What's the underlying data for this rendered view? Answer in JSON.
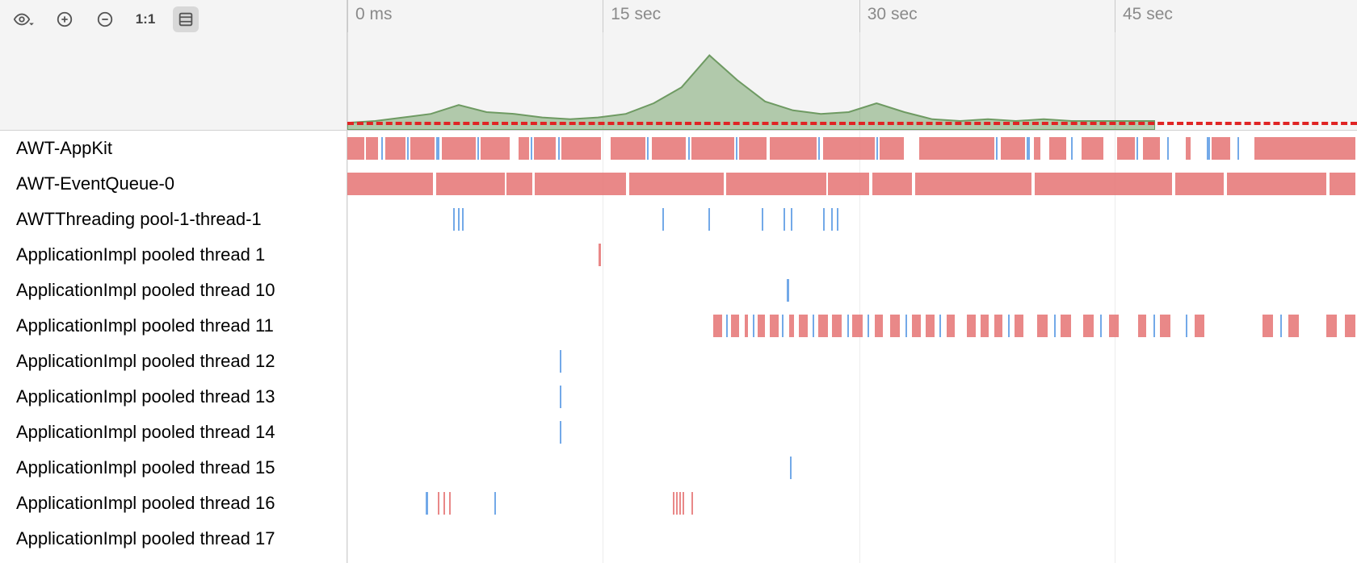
{
  "toolbar": {
    "eye_label": "visibility",
    "zoom_in_label": "zoom-in",
    "zoom_out_label": "zoom-out",
    "actual_size_label": "1:1",
    "boxed_label": "toggle-collapse"
  },
  "time_axis": {
    "ticks": [
      {
        "pct": 0,
        "label": "0 ms"
      },
      {
        "pct": 25.3,
        "label": "15 sec"
      },
      {
        "pct": 50.7,
        "label": "30 sec"
      },
      {
        "pct": 76.0,
        "label": "45 sec"
      }
    ],
    "grid_pct": [
      0,
      25.3,
      50.7,
      76.0
    ]
  },
  "chart_data": {
    "type": "area",
    "title": "",
    "xlabel": "time",
    "ylabel": "",
    "x_unit": "sec",
    "ylim": [
      0,
      100
    ],
    "baseline_pct": 8,
    "x": [
      0,
      2,
      4,
      6,
      8,
      10,
      12,
      14,
      16,
      18,
      20,
      22,
      24,
      26,
      28,
      30,
      32,
      34,
      36,
      38,
      40,
      42,
      44,
      46,
      48,
      50,
      52,
      54,
      56,
      58
    ],
    "values": [
      8,
      10,
      14,
      18,
      28,
      20,
      18,
      14,
      12,
      14,
      18,
      30,
      48,
      84,
      56,
      32,
      22,
      18,
      20,
      30,
      20,
      12,
      10,
      12,
      10,
      12,
      10,
      10,
      10,
      10
    ]
  },
  "threads": [
    {
      "name": "AWT-AppKit",
      "events": [
        {
          "s": 0,
          "e": 1.0,
          "c": "red"
        },
        {
          "s": 1.1,
          "e": 1.8,
          "c": "red"
        },
        {
          "s": 2.0,
          "e": 2.1,
          "c": "blue"
        },
        {
          "s": 2.2,
          "e": 3.4,
          "c": "red"
        },
        {
          "s": 3.5,
          "e": 3.6,
          "c": "blue"
        },
        {
          "s": 3.7,
          "e": 5.1,
          "c": "red"
        },
        {
          "s": 5.2,
          "e": 5.4,
          "c": "blue"
        },
        {
          "s": 5.5,
          "e": 7.5,
          "c": "red"
        },
        {
          "s": 7.6,
          "e": 7.7,
          "c": "blue"
        },
        {
          "s": 7.8,
          "e": 9.5,
          "c": "red"
        },
        {
          "s": 10.0,
          "e": 10.6,
          "c": "red"
        },
        {
          "s": 10.7,
          "e": 10.8,
          "c": "blue"
        },
        {
          "s": 10.9,
          "e": 12.2,
          "c": "red"
        },
        {
          "s": 12.3,
          "e": 12.4,
          "c": "blue"
        },
        {
          "s": 12.5,
          "e": 14.8,
          "c": "red"
        },
        {
          "s": 15.4,
          "e": 17.4,
          "c": "red"
        },
        {
          "s": 17.5,
          "e": 17.6,
          "c": "blue"
        },
        {
          "s": 17.8,
          "e": 19.8,
          "c": "red"
        },
        {
          "s": 19.9,
          "e": 20.0,
          "c": "blue"
        },
        {
          "s": 20.1,
          "e": 22.6,
          "c": "red"
        },
        {
          "s": 22.7,
          "e": 22.8,
          "c": "blue"
        },
        {
          "s": 22.9,
          "e": 24.5,
          "c": "red"
        },
        {
          "s": 24.7,
          "e": 27.4,
          "c": "red"
        },
        {
          "s": 27.5,
          "e": 27.6,
          "c": "blue"
        },
        {
          "s": 27.8,
          "e": 30.8,
          "c": "red"
        },
        {
          "s": 30.9,
          "e": 31.0,
          "c": "blue"
        },
        {
          "s": 31.1,
          "e": 32.5,
          "c": "red"
        },
        {
          "s": 33.4,
          "e": 37.8,
          "c": "red"
        },
        {
          "s": 37.9,
          "e": 38.0,
          "c": "blue"
        },
        {
          "s": 38.2,
          "e": 39.6,
          "c": "red"
        },
        {
          "s": 39.7,
          "e": 39.9,
          "c": "blue"
        },
        {
          "s": 40.1,
          "e": 40.5,
          "c": "red"
        },
        {
          "s": 41.0,
          "e": 42.0,
          "c": "red"
        },
        {
          "s": 42.3,
          "e": 42.4,
          "c": "blue"
        },
        {
          "s": 42.9,
          "e": 44.2,
          "c": "red"
        },
        {
          "s": 45.0,
          "e": 46.0,
          "c": "red"
        },
        {
          "s": 46.1,
          "e": 46.2,
          "c": "blue"
        },
        {
          "s": 46.5,
          "e": 47.5,
          "c": "red"
        },
        {
          "s": 47.9,
          "e": 48.0,
          "c": "blue"
        },
        {
          "s": 49.0,
          "e": 49.3,
          "c": "red"
        },
        {
          "s": 50.2,
          "e": 50.4,
          "c": "blue"
        },
        {
          "s": 50.5,
          "e": 51.6,
          "c": "red"
        },
        {
          "s": 52.0,
          "e": 52.1,
          "c": "blue"
        },
        {
          "s": 53.0,
          "e": 58.9,
          "c": "red"
        }
      ]
    },
    {
      "name": "AWT-EventQueue-0",
      "events": [
        {
          "s": 0,
          "e": 5.0,
          "c": "red"
        },
        {
          "s": 5.2,
          "e": 9.2,
          "c": "red"
        },
        {
          "s": 9.3,
          "e": 10.8,
          "c": "red"
        },
        {
          "s": 10.95,
          "e": 16.3,
          "c": "red"
        },
        {
          "s": 16.45,
          "e": 22.0,
          "c": "red"
        },
        {
          "s": 22.15,
          "e": 28.0,
          "c": "red"
        },
        {
          "s": 28.1,
          "e": 30.5,
          "c": "red"
        },
        {
          "s": 30.7,
          "e": 33.0,
          "c": "red"
        },
        {
          "s": 33.2,
          "e": 40.0,
          "c": "red"
        },
        {
          "s": 40.15,
          "e": 48.2,
          "c": "red"
        },
        {
          "s": 48.4,
          "e": 51.2,
          "c": "red"
        },
        {
          "s": 51.4,
          "e": 57.2,
          "c": "red"
        },
        {
          "s": 57.4,
          "e": 58.9,
          "c": "red"
        }
      ]
    },
    {
      "name": "AWTThreading pool-1-thread-1",
      "events": [
        {
          "s": 6.2,
          "e": 6.3,
          "c": "blue"
        },
        {
          "s": 6.45,
          "e": 6.55,
          "c": "blue"
        },
        {
          "s": 6.7,
          "e": 6.8,
          "c": "blue"
        },
        {
          "s": 18.4,
          "e": 18.5,
          "c": "blue"
        },
        {
          "s": 21.1,
          "e": 21.2,
          "c": "blue"
        },
        {
          "s": 24.2,
          "e": 24.3,
          "c": "blue"
        },
        {
          "s": 25.5,
          "e": 25.6,
          "c": "blue"
        },
        {
          "s": 25.9,
          "e": 26.0,
          "c": "blue"
        },
        {
          "s": 27.8,
          "e": 27.9,
          "c": "blue"
        },
        {
          "s": 28.25,
          "e": 28.35,
          "c": "blue"
        },
        {
          "s": 28.6,
          "e": 28.7,
          "c": "blue"
        }
      ]
    },
    {
      "name": "ApplicationImpl pooled thread 1",
      "events": [
        {
          "s": 14.7,
          "e": 14.8,
          "c": "red"
        }
      ]
    },
    {
      "name": "ApplicationImpl pooled thread 10",
      "events": [
        {
          "s": 25.7,
          "e": 25.8,
          "c": "blue"
        }
      ]
    },
    {
      "name": "ApplicationImpl pooled thread 11",
      "events": [
        {
          "s": 21.4,
          "e": 21.9,
          "c": "red"
        },
        {
          "s": 22.15,
          "e": 22.25,
          "c": "blue"
        },
        {
          "s": 22.4,
          "e": 22.9,
          "c": "red"
        },
        {
          "s": 23.2,
          "e": 23.4,
          "c": "red"
        },
        {
          "s": 23.7,
          "e": 23.8,
          "c": "blue"
        },
        {
          "s": 24.0,
          "e": 24.4,
          "c": "red"
        },
        {
          "s": 24.7,
          "e": 25.2,
          "c": "red"
        },
        {
          "s": 25.4,
          "e": 25.5,
          "c": "blue"
        },
        {
          "s": 25.8,
          "e": 26.1,
          "c": "red"
        },
        {
          "s": 26.4,
          "e": 26.9,
          "c": "red"
        },
        {
          "s": 27.2,
          "e": 27.3,
          "c": "blue"
        },
        {
          "s": 27.5,
          "e": 28.1,
          "c": "red"
        },
        {
          "s": 28.3,
          "e": 28.9,
          "c": "red"
        },
        {
          "s": 29.2,
          "e": 29.3,
          "c": "blue"
        },
        {
          "s": 29.5,
          "e": 30.1,
          "c": "red"
        },
        {
          "s": 30.4,
          "e": 30.5,
          "c": "blue"
        },
        {
          "s": 30.8,
          "e": 31.3,
          "c": "red"
        },
        {
          "s": 31.7,
          "e": 32.3,
          "c": "red"
        },
        {
          "s": 32.6,
          "e": 32.7,
          "c": "blue"
        },
        {
          "s": 33.0,
          "e": 33.5,
          "c": "red"
        },
        {
          "s": 33.8,
          "e": 34.3,
          "c": "red"
        },
        {
          "s": 34.6,
          "e": 34.7,
          "c": "blue"
        },
        {
          "s": 35.0,
          "e": 35.5,
          "c": "red"
        },
        {
          "s": 36.2,
          "e": 36.7,
          "c": "red"
        },
        {
          "s": 37.0,
          "e": 37.5,
          "c": "red"
        },
        {
          "s": 37.8,
          "e": 38.3,
          "c": "red"
        },
        {
          "s": 38.6,
          "e": 38.7,
          "c": "blue"
        },
        {
          "s": 39.0,
          "e": 39.5,
          "c": "red"
        },
        {
          "s": 40.3,
          "e": 40.9,
          "c": "red"
        },
        {
          "s": 41.3,
          "e": 41.4,
          "c": "blue"
        },
        {
          "s": 41.7,
          "e": 42.3,
          "c": "red"
        },
        {
          "s": 43.0,
          "e": 43.6,
          "c": "red"
        },
        {
          "s": 44.0,
          "e": 44.1,
          "c": "blue"
        },
        {
          "s": 44.5,
          "e": 45.1,
          "c": "red"
        },
        {
          "s": 46.2,
          "e": 46.7,
          "c": "red"
        },
        {
          "s": 47.1,
          "e": 47.2,
          "c": "blue"
        },
        {
          "s": 47.5,
          "e": 48.1,
          "c": "red"
        },
        {
          "s": 49.0,
          "e": 49.1,
          "c": "blue"
        },
        {
          "s": 49.5,
          "e": 50.1,
          "c": "red"
        },
        {
          "s": 53.5,
          "e": 54.1,
          "c": "red"
        },
        {
          "s": 54.5,
          "e": 54.6,
          "c": "blue"
        },
        {
          "s": 55.0,
          "e": 55.6,
          "c": "red"
        },
        {
          "s": 57.2,
          "e": 57.8,
          "c": "red"
        },
        {
          "s": 58.3,
          "e": 58.9,
          "c": "red"
        }
      ]
    },
    {
      "name": "ApplicationImpl pooled thread 12",
      "events": [
        {
          "s": 12.4,
          "e": 12.5,
          "c": "blue"
        }
      ]
    },
    {
      "name": "ApplicationImpl pooled thread 13",
      "events": [
        {
          "s": 12.4,
          "e": 12.5,
          "c": "blue"
        }
      ]
    },
    {
      "name": "ApplicationImpl pooled thread 14",
      "events": [
        {
          "s": 12.4,
          "e": 12.5,
          "c": "blue"
        }
      ]
    },
    {
      "name": "ApplicationImpl pooled thread 15",
      "events": [
        {
          "s": 25.85,
          "e": 25.95,
          "c": "blue"
        }
      ]
    },
    {
      "name": "ApplicationImpl pooled thread 16",
      "events": [
        {
          "s": 4.6,
          "e": 4.7,
          "c": "blue"
        },
        {
          "s": 5.3,
          "e": 5.4,
          "c": "red"
        },
        {
          "s": 5.6,
          "e": 5.7,
          "c": "red"
        },
        {
          "s": 5.95,
          "e": 6.05,
          "c": "red"
        },
        {
          "s": 8.6,
          "e": 8.7,
          "c": "blue"
        },
        {
          "s": 19.0,
          "e": 19.1,
          "c": "red"
        },
        {
          "s": 19.2,
          "e": 19.3,
          "c": "red"
        },
        {
          "s": 19.4,
          "e": 19.5,
          "c": "red"
        },
        {
          "s": 19.6,
          "e": 19.7,
          "c": "red"
        },
        {
          "s": 20.1,
          "e": 20.2,
          "c": "red"
        }
      ]
    },
    {
      "name": "ApplicationImpl pooled thread 17",
      "events": []
    }
  ]
}
